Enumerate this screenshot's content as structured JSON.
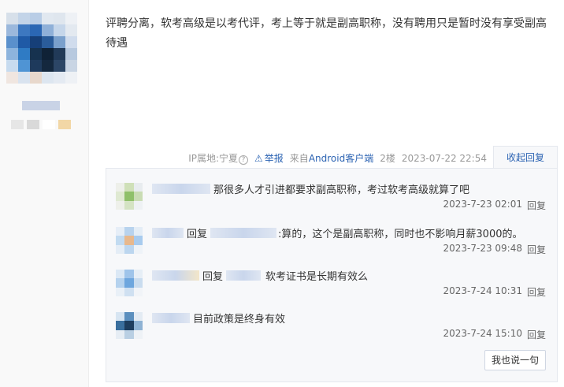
{
  "post": {
    "text": "评聘分离，软考高级是以考代评，考上等于就是副高职称，没有聘用只是暂时没有享受副高待遇"
  },
  "meta": {
    "ip_location": "IP属地:宁夏",
    "help_icon": "question-icon",
    "report_label": "举报",
    "client_prefix": "来自",
    "client_name": "Android客户端",
    "floor": "2楼",
    "datetime": "2023-07-22 22:54"
  },
  "collapse_label": "收起回复",
  "replies": [
    {
      "prefix": "",
      "target_visible": false,
      "text": "那很多人才引进都要求副高职称，考过软考高级就算了吧",
      "time": "2023-7-23 02:01",
      "reply_label": "回复"
    },
    {
      "prefix": "回复",
      "target_visible": true,
      "text": ":算的，这个是副高职称，同时也不影响月薪3000的。",
      "time": "2023-7-23 09:48",
      "reply_label": "回复"
    },
    {
      "prefix": "回复",
      "target_visible": true,
      "text": "软考证书是长期有效么",
      "time": "2023-7-24 10:31",
      "reply_label": "回复"
    },
    {
      "prefix": "",
      "target_visible": false,
      "text": "目前政策是终身有效",
      "time": "2023-7-24 15:10",
      "reply_label": "回复"
    }
  ],
  "say_button": "我也说一句",
  "colors": {
    "link": "#2d64b3",
    "reply_bg": "#f7f8fa",
    "border": "#e5e8ee"
  }
}
